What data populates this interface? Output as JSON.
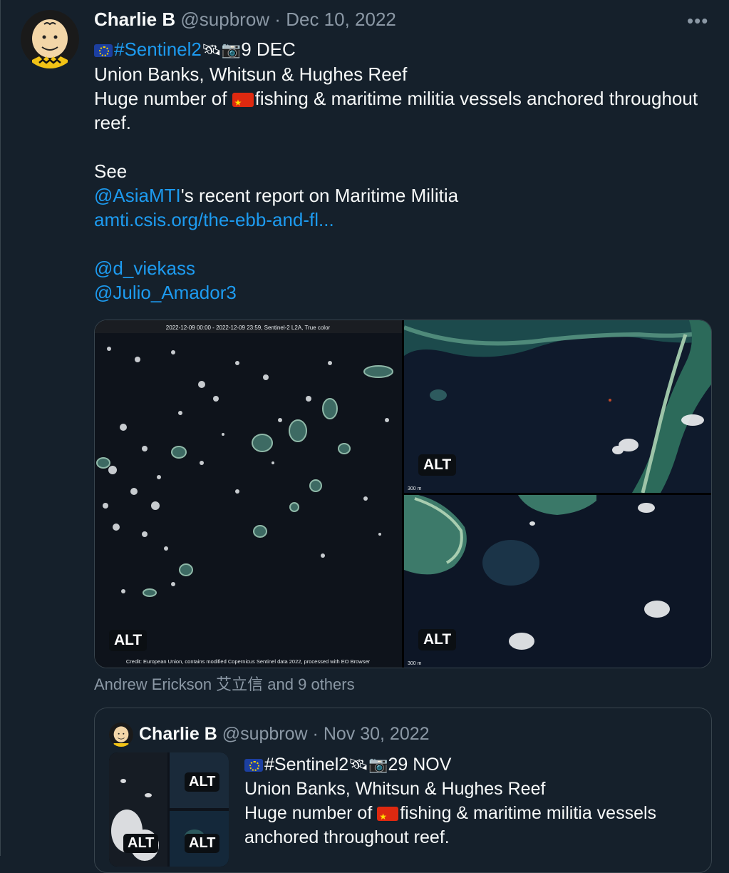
{
  "tweet": {
    "author_name": "Charlie B",
    "handle": "@supbrow",
    "separator": "·",
    "date": "Dec 10, 2022",
    "more_label": "•••",
    "line1_hashtag": "#Sentinel2",
    "line1_date": "9 DEC",
    "line2": "Union Banks, Whitsun & Hughes Reef",
    "line3_a": "Huge number of ",
    "line3_b": "fishing & maritime militia vessels anchored throughout",
    "line4": "reef.",
    "line5": "See",
    "mention_amti": "@AsiaMTI",
    "mention_amti_tail": "'s recent report on Maritime Militia",
    "link": "amti.csis.org/the-ebb-and-fl...",
    "mention1": "@d_viekass",
    "mention2": "@Julio_Amador3"
  },
  "media": {
    "alt_label": "ALT",
    "image1_caption": "2022-12-09 00:00 - 2022-12-09 23:59, Sentinel-2 L2A, True color",
    "image1_credit": "Credit: European Union, contains modified Copernicus Sentinel data 2022, processed with EO Browser",
    "image_scale": "300 m"
  },
  "likers": "Andrew Erickson 艾立信 and 9 others",
  "quote": {
    "author_name": "Charlie B",
    "handle": "@supbrow",
    "separator": "·",
    "date": "Nov 30, 2022",
    "line1_hashtag": "#Sentinel2",
    "line1_date": "29 NOV",
    "line2": "Union Banks, Whitsun & Hughes Reef",
    "line3_a": "Huge number of ",
    "line3_b": "fishing & maritime militia vessels",
    "line4": "anchored throughout reef.",
    "alt_label": "ALT"
  },
  "icons": {
    "eu_flag": "eu-flag-icon",
    "cn_flag": "china-flag-icon",
    "satellite": "satellite-icon",
    "camera": "camera-icon"
  },
  "colors": {
    "background": "#15202b",
    "link": "#1d9bf0",
    "muted": "#8b98a5",
    "border": "#38444d"
  }
}
